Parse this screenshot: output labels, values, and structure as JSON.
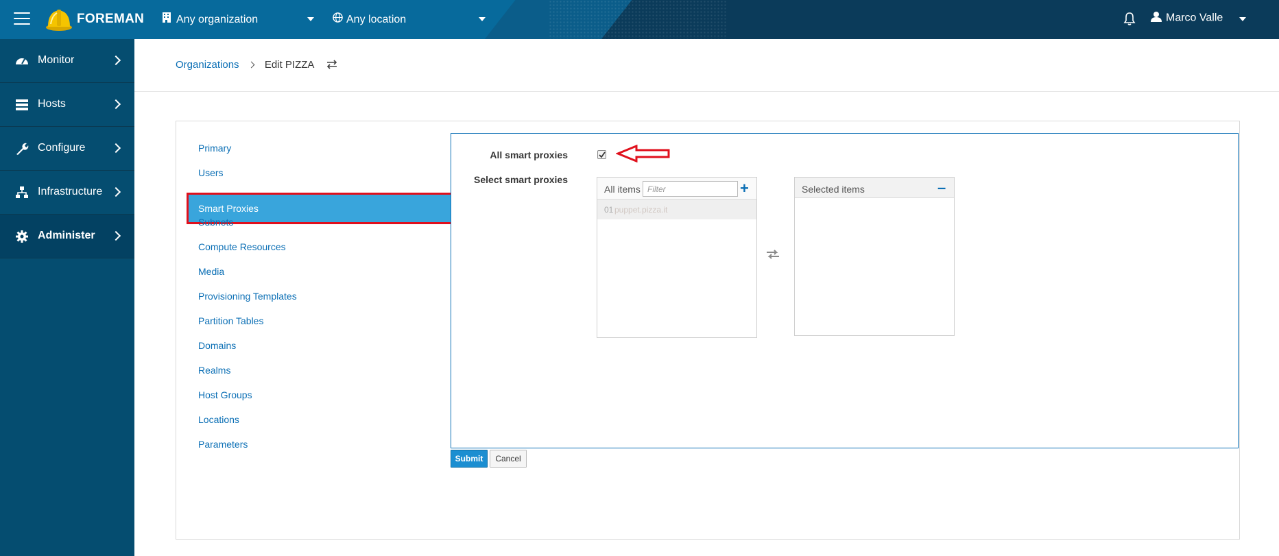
{
  "header": {
    "brand": "FOREMAN",
    "organization": "Any organization",
    "location": "Any location",
    "user_name": "Marco Valle"
  },
  "sidebar": {
    "items": [
      {
        "label": "Monitor",
        "icon": "dashboard-icon"
      },
      {
        "label": "Hosts",
        "icon": "server-icon"
      },
      {
        "label": "Configure",
        "icon": "wrench-icon"
      },
      {
        "label": "Infrastructure",
        "icon": "network-icon"
      },
      {
        "label": "Administer",
        "icon": "gear-icon",
        "active": true
      }
    ]
  },
  "breadcrumb": {
    "parent": "Organizations",
    "current": "Edit PIZZA"
  },
  "tabs": [
    "Primary",
    "Users",
    "Smart Proxies",
    "Subnets",
    "Compute Resources",
    "Media",
    "Provisioning Templates",
    "Partition Tables",
    "Domains",
    "Realms",
    "Host Groups",
    "Locations",
    "Parameters"
  ],
  "active_tab": "Smart Proxies",
  "form": {
    "all_label": "All smart proxies",
    "all_checked": true,
    "select_label": "Select smart proxies",
    "all_items_title": "All items",
    "filter_placeholder": "Filter",
    "items": [
      {
        "num": "01",
        "name": "puppet.pizza.it"
      }
    ],
    "selected_title": "Selected items",
    "submit": "Submit",
    "cancel": "Cancel"
  },
  "colors": {
    "topbar": "#0b3b5a",
    "sidebar": "#054d70",
    "link": "#0b6fb5",
    "active_tab": "#39a5dc",
    "highlight": "#e0101c"
  }
}
